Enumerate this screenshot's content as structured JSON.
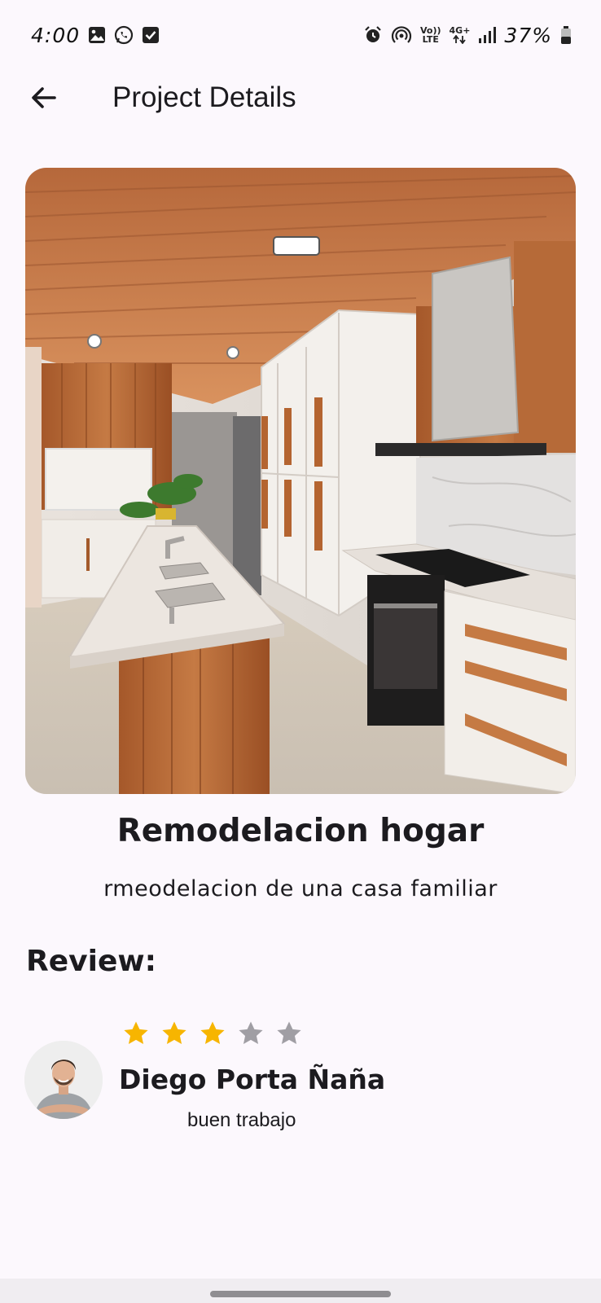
{
  "status_bar": {
    "time": "4:00",
    "network_label_top": "Vo))",
    "network_label_bottom": "LTE",
    "data_label_top": "4G+",
    "battery_percent": "37%",
    "left_icons": [
      "gallery-icon",
      "whatsapp-icon",
      "checkbox-icon"
    ],
    "right_icons": [
      "alarm-icon",
      "hotspot-icon",
      "volte-icon",
      "data-4g-icon",
      "signal-icon",
      "battery-icon"
    ]
  },
  "app_bar": {
    "title": "Project Details",
    "back_icon": "arrow-left-icon"
  },
  "project": {
    "title": "Remodelacion hogar",
    "description": "rmeodelacion de una casa familiar",
    "image": "kitchen-remodel-photo"
  },
  "review_section": {
    "heading": "Review:",
    "reviews": [
      {
        "name": "Diego Porta Ñaña",
        "comment": "buen trabajo",
        "rating": 3,
        "max_rating": 5
      }
    ]
  },
  "colors": {
    "background": "#fcf8fd",
    "text": "#1c1b1f",
    "star_filled": "#f7b500",
    "star_empty": "#a09ea4"
  }
}
